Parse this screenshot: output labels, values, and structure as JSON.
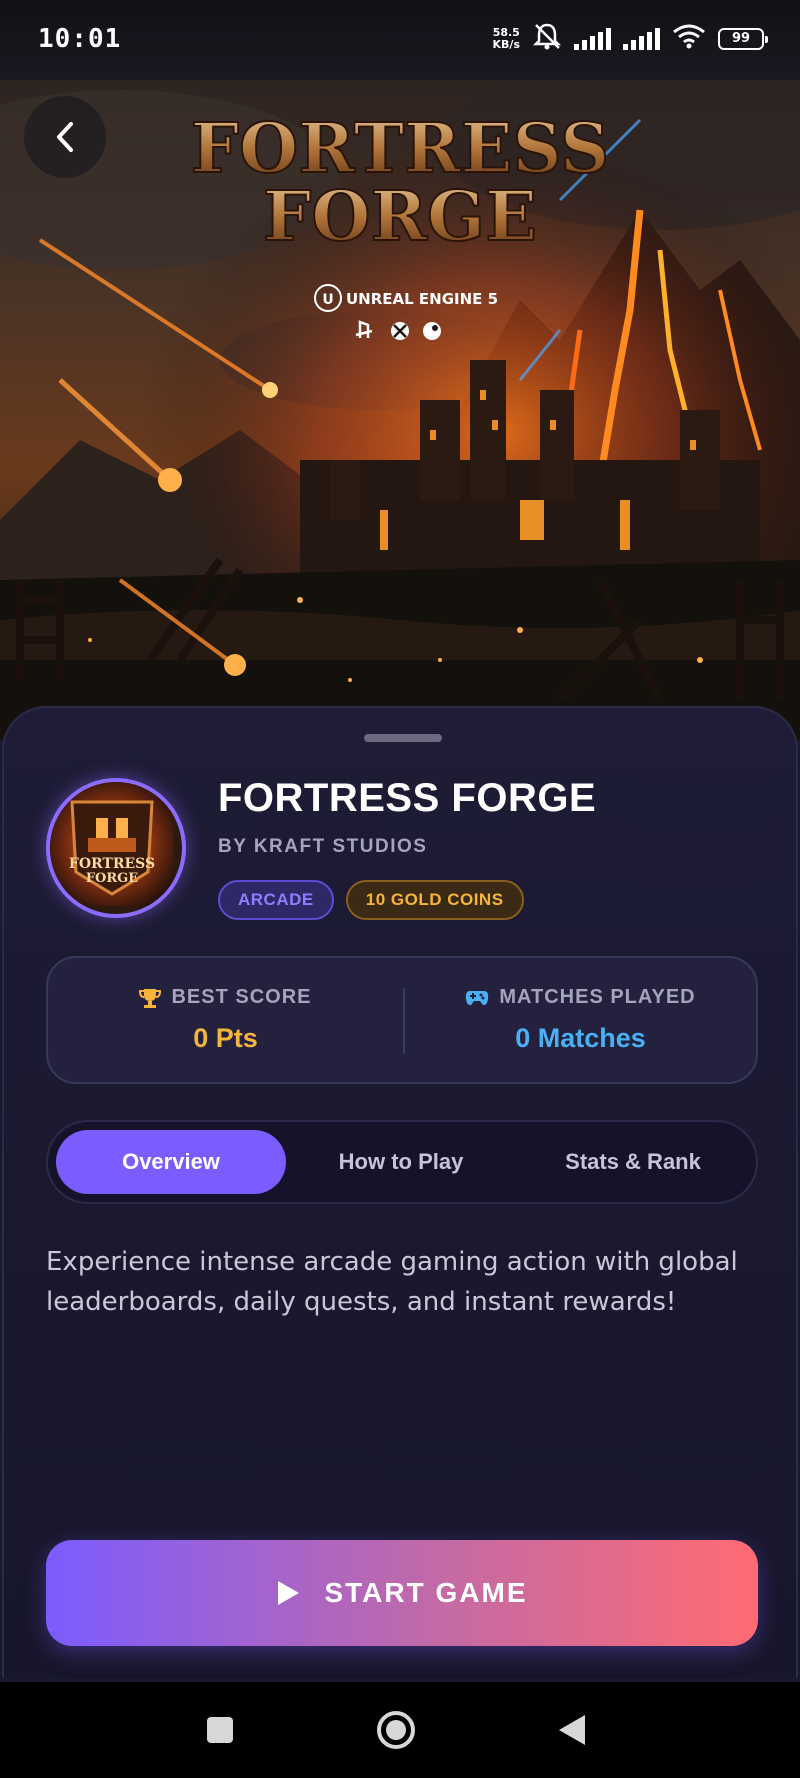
{
  "status_bar": {
    "time": "10:01",
    "net_speed_value": "58.5",
    "net_speed_unit": "KB/s",
    "battery": "99"
  },
  "hero": {
    "logo_line1": "FORTRESS",
    "logo_line2": "FORGE",
    "engine_label": "UNREAL ENGINE 5",
    "platform_icons": [
      "playstation-icon",
      "xbox-icon",
      "steam-icon"
    ]
  },
  "game": {
    "title": "FORTRESS FORGE",
    "studio": "BY KRAFT STUDIOS",
    "logo_text_line1": "FORTRESS",
    "logo_text_line2": "FORGE",
    "tags": [
      {
        "label": "ARCADE"
      },
      {
        "label": "10 GOLD COINS"
      }
    ]
  },
  "stats": {
    "best_score_label": "BEST SCORE",
    "best_score_value": "0 Pts",
    "matches_label": "MATCHES PLAYED",
    "matches_value": "0 Matches"
  },
  "tabs": [
    {
      "label": "Overview",
      "active": true
    },
    {
      "label": "How to Play",
      "active": false
    },
    {
      "label": "Stats & Rank",
      "active": false
    }
  ],
  "description": "Experience intense arcade gaming action with global leaderboards, daily quests, and instant rewards!",
  "start_button": {
    "label": "START GAME"
  },
  "colors": {
    "accent": "#7a5cff",
    "gold": "#f5b53a",
    "blue": "#4ab0f5",
    "gradient_end": "#ff6b73"
  },
  "icons": {
    "back": "chevron-left-icon",
    "trophy": "trophy-icon",
    "gamepad": "gamepad-icon",
    "play": "play-icon"
  }
}
